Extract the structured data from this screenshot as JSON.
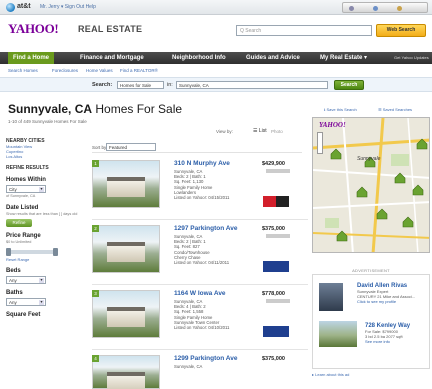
{
  "browser": {
    "brand": "at&t",
    "account_links": "Mr. Jerry ▾   Sign Out   Help"
  },
  "header": {
    "logo": "YAHOO!",
    "section": "REAL ESTATE",
    "search_placeholder": "Q Search",
    "search_button": "Web Search"
  },
  "nav": {
    "items": [
      "Find a Home",
      "Finance and Mortgage",
      "Neighborhood Info",
      "Guides and Advice",
      "My Real Estate ▾"
    ],
    "extra": "Get Yahoo Updates"
  },
  "subnav": {
    "links": [
      "Search Homes",
      "Foreclosures",
      "Home Values",
      "Find a REALTOR®"
    ]
  },
  "searchbar": {
    "label": "Search:",
    "type_value": "Homes for Sale",
    "in_label": "in:",
    "location_value": "Sunnyvale, CA",
    "button": "Search"
  },
  "page": {
    "title_city": "Sunnyvale, CA",
    "title_rest": "Homes For Sale",
    "results": "1-10 of 449 Sunnyvale Homes For Sale",
    "view_by": "View by:",
    "view_list": "☰ List",
    "view_photo": "Photo",
    "save_search": "⭳ Save this Search",
    "saved_searches": "☰ Saved Searches"
  },
  "sidebar": {
    "nearby_title": "NEARBY CITIES",
    "nearby": [
      "Mountain View",
      "Cupertino",
      "Los Altos"
    ],
    "refine_title": "REFINE RESULTS",
    "homes_within_title": "Homes Within",
    "homes_within_value": "City",
    "homes_within_note": "of Sunnyvale, CA",
    "date_listed_title": "Date Listed",
    "date_listed_note": "Show results that are less than [ ] days old",
    "refine_button": "Refine",
    "price_title": "Price Range",
    "price_note": "$0 to Unlimited",
    "reset_range": "Reset Range",
    "beds_title": "Beds",
    "beds_value": "Any",
    "baths_title": "Baths",
    "baths_value": "Any",
    "sqft_title": "Square Feet"
  },
  "sort": {
    "label": "Sort by:",
    "value": "Featured"
  },
  "listings": [
    {
      "num": "1",
      "address": "310 N Murphy Ave",
      "price": "$429,900",
      "details": [
        "Sunnyvale, CA",
        "Beds: 2 | Bath: 1",
        "Sq. Feet: 1,130",
        "Single Family Home",
        "Lowlanders",
        "Listed on Yahoo!: 04/15/2011"
      ]
    },
    {
      "num": "2",
      "address": "1297 Parkington Ave",
      "price": "$375,000",
      "details": [
        "Sunnyvale, CA",
        "Beds: 2 | Bath: 1",
        "Sq. Feet: 827",
        "Condo/Townhouse",
        "Cherry Chase",
        "Listed on Yahoo!: 04/11/2011"
      ]
    },
    {
      "num": "3",
      "address": "1164 W Iowa Ave",
      "price": "$778,000",
      "details": [
        "Sunnyvale, CA",
        "Beds: 4 | Bath: 2",
        "Sq. Feet: 1,558",
        "Single Family Home",
        "Sunnyvale Town Center",
        "Listed on Yahoo!: 04/10/2011"
      ]
    },
    {
      "num": "4",
      "address": "1299 Parkington Ave",
      "price": "$375,000",
      "details": [
        "Sunnyvale, CA"
      ]
    }
  ],
  "map": {
    "tag": "YAHOO!",
    "city_label": "Sunnyvale"
  },
  "ad": {
    "heading": "ADVERTISEMENT",
    "agent_name": "David Allen Rivas",
    "agent_lines": [
      "Sunnyvale Expert",
      "CENTURY 21 Mike and Associ...",
      "Click to see my profile"
    ],
    "prop_address": "728 Kenley Way",
    "prop_lines": [
      "For Sale: $799000",
      "3 bd 2.5 ba 2077 sqft",
      "See more info"
    ],
    "footer": "▸ Learn about this ad"
  },
  "colors": {
    "brand_purple": "#7b0099",
    "nav_green": "#6a9a1d",
    "link_blue": "#2a5da8",
    "search_yellow": "#f2ad19"
  }
}
